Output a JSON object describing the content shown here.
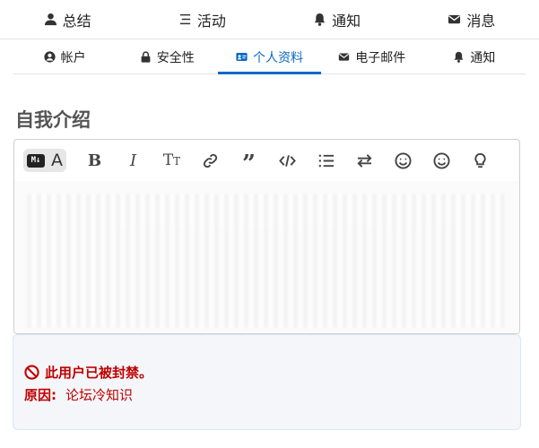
{
  "primary_nav": {
    "items": [
      {
        "label": "总结",
        "icon": "user-icon"
      },
      {
        "label": "活动",
        "icon": "list-icon"
      },
      {
        "label": "通知",
        "icon": "bell-icon"
      },
      {
        "label": "消息",
        "icon": "envelope-icon"
      }
    ]
  },
  "secondary_nav": {
    "items": [
      {
        "label": "帐户",
        "icon": "user-circle-icon"
      },
      {
        "label": "安全性",
        "icon": "lock-icon"
      },
      {
        "label": "个人资料",
        "icon": "id-card-icon",
        "active": true
      },
      {
        "label": "电子邮件",
        "icon": "envelope-icon"
      },
      {
        "label": "通知",
        "icon": "bell-icon"
      }
    ]
  },
  "section": {
    "title": "自我介绍"
  },
  "editor": {
    "toolbar": {
      "markdown_badge": "M↓",
      "mode_letter": "A",
      "bold_label": "B",
      "italic_label": "I",
      "text_size_label": "T",
      "text_size_small": "T",
      "quote_label": "”"
    }
  },
  "notice": {
    "title": "此用户已被封禁。",
    "reason_label": "原因:",
    "reason_value": "论坛冷知识"
  },
  "colors": {
    "accent": "#0a6ac2",
    "danger": "#c00000",
    "notice_bg": "#f4f6f9"
  }
}
